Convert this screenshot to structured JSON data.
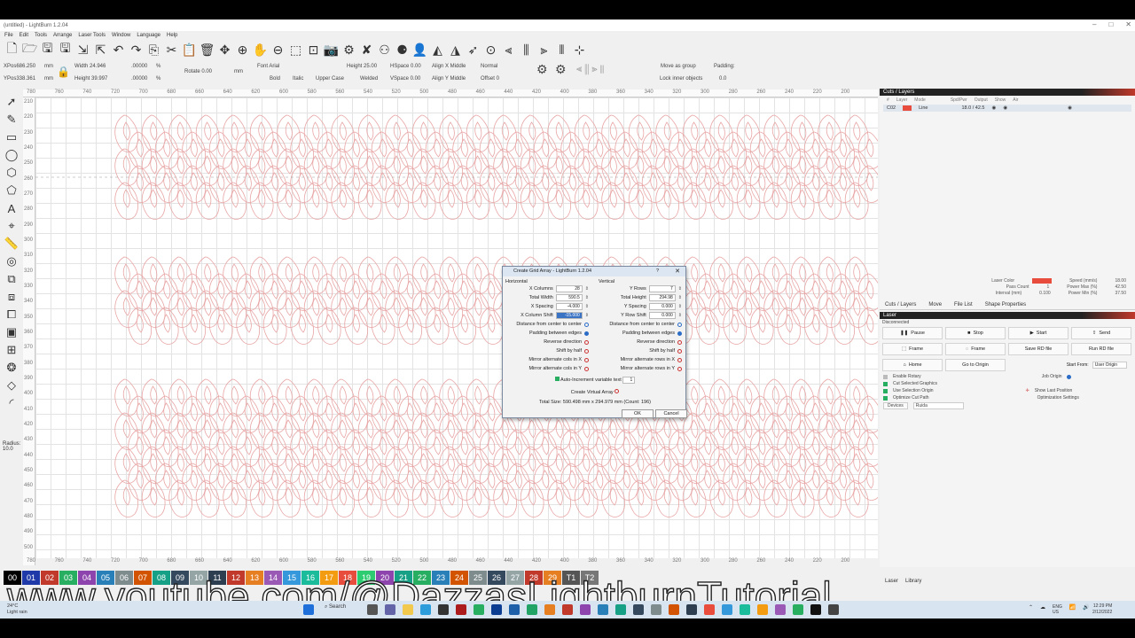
{
  "window": {
    "title": "(untitled) - LightBurn 1.2.04"
  },
  "menu": [
    "File",
    "Edit",
    "Tools",
    "Arrange",
    "Laser Tools",
    "Window",
    "Language",
    "Help"
  ],
  "toolbar2": {
    "xpos": "XPos686.250",
    "ypos": "YPos338.361",
    "mm": "mm",
    "width": "Width 24.946",
    "height": "Height 39.997",
    "pct_x": ".00000",
    "pct_y": ".00000",
    "pct": "%",
    "rotate": "Rotate 0.00",
    "rotate_mm": "mm",
    "font": "Font Arial",
    "font_height": "Height 25.00",
    "hspace": "HSpace 0.00",
    "vspace": "VSpace 0.00",
    "align_x": "Align X Middle",
    "align_y": "Align Y Middle",
    "normal": "Normal",
    "offset": "Offset 0",
    "bold": "Bold",
    "italic": "Italic",
    "upper": "Upper Case",
    "welded": "Welded",
    "move_group": "Move as group",
    "lock_inner": "Lock inner objects",
    "padding_label": "Padding:",
    "padding_value": "0.0"
  },
  "rulers": {
    "top": [
      "780",
      "760",
      "740",
      "720",
      "700",
      "680",
      "660",
      "640",
      "620",
      "600",
      "580",
      "560",
      "540",
      "520",
      "500",
      "480",
      "460",
      "440",
      "420",
      "400",
      "380",
      "360",
      "340",
      "320",
      "300",
      "280",
      "260",
      "240",
      "220",
      "200"
    ],
    "left": [
      "210",
      "220",
      "230",
      "240",
      "250",
      "260",
      "270",
      "280",
      "290",
      "300",
      "310",
      "320",
      "330",
      "340",
      "350",
      "360",
      "370",
      "380",
      "390",
      "400",
      "410",
      "420",
      "430",
      "440",
      "450",
      "460",
      "470",
      "480",
      "490",
      "500"
    ]
  },
  "radius": "Radius:",
  "radius_value": "10.0",
  "dialog": {
    "title": "Create Grid Array - LightBurn 1.2.04",
    "help": "?",
    "close": "✕",
    "horizontal": "Horizontal",
    "vertical": "Vertical",
    "h": {
      "x_columns_label": "X Columns",
      "x_columns": "28",
      "total_width_label": "Total Width",
      "total_width": "590.5",
      "x_spacing_label": "X Spacing",
      "x_spacing": "-4.000",
      "x_col_shift_label": "X Column Shift",
      "x_col_shift": "-15.000",
      "center": "Distance from center to center",
      "padding": "Padding between edges",
      "reverse": "Reverse direction",
      "shift_half": "Shift by half",
      "mirror_x": "Mirror alternate cols in X",
      "mirror_y": "Mirror alternate cols in Y"
    },
    "v": {
      "y_rows_label": "Y Rows",
      "y_rows": "7",
      "total_height_label": "Total Height",
      "total_height": "294.98",
      "y_spacing_label": "Y Spacing",
      "y_spacing": "0.000",
      "y_row_shift_label": "Y Row Shift",
      "y_row_shift": "0.000",
      "center": "Distance from center to center",
      "padding": "Padding between edges",
      "reverse": "Reverse direction",
      "shift_half": "Shift by half",
      "mirror_x": "Mirror alternate rows in X",
      "mirror_y": "Mirror alternate rows in Y"
    },
    "auto_inc_label": "Auto-Increment variable text",
    "auto_inc_value": "1",
    "virtual": "Create Virtual Array",
    "total": "Total Size: 590.498 mm x 294.979 mm  (Count: 196)",
    "ok": "OK",
    "cancel": "Cancel"
  },
  "cuts": {
    "header": "Cuts / Layers",
    "cols": [
      "#",
      "Layer",
      "Mode",
      "Spd/Pwr",
      "Output",
      "Show",
      "Air"
    ],
    "layer_num": "C02",
    "layer_mode": "Line",
    "layer_spd": "18.0 / 42.5",
    "layer_color": "#e74c3c"
  },
  "laser_props": {
    "laser_color": "Laser Color",
    "speed": "Speed (mm/s)",
    "speed_v": "18.00",
    "pass": "Pass Count",
    "pass_v": "1",
    "pmax": "Power Max (%)",
    "pmax_v": "42.50",
    "interval": "Interval (mm)",
    "interval_v": "0.100",
    "pmin": "Power Min (%)",
    "pmin_v": "37.50"
  },
  "tabs": [
    "Cuts / Layers",
    "Move",
    "File List",
    "Shape Properties"
  ],
  "laser": {
    "header": "Laser",
    "status": "Disconnected",
    "buttons": [
      "Pause",
      "Stop",
      "Start",
      "Send",
      "Frame",
      "Frame",
      "Save RD file",
      "Run RD file",
      "Home",
      "Go to Origin"
    ],
    "start_from": "Start From:",
    "start_from_v": "User Origin",
    "job_origin": "Job Origin",
    "enable_rotary": "Enable Rotary",
    "cut_selected": "Cut Selected Graphics",
    "use_selection": "Use Selection Origin",
    "optimize": "Optimize Cut Path",
    "show_last": "Show Last Position",
    "opt_settings": "Optimization Settings",
    "devices": "Devices",
    "device_name": "Ruida"
  },
  "bottom_tabs": [
    "Laser",
    "Library"
  ],
  "palette": [
    "00",
    "01",
    "02",
    "03",
    "04",
    "05",
    "06",
    "07",
    "08",
    "09",
    "10",
    "11",
    "12",
    "13",
    "14",
    "15",
    "16",
    "17",
    "18",
    "19",
    "20",
    "21",
    "22",
    "23",
    "24",
    "25",
    "26",
    "27",
    "28",
    "29",
    "T1",
    "T2"
  ],
  "watermark": "www.youtube.com/@DazzasLightburnTutorial",
  "taskbar": {
    "temp": "24°C",
    "weather": "Light rain",
    "search": "Search",
    "lang1": "ENG",
    "lang2": "US",
    "time": "12:29 PM",
    "date": "2/12/2022"
  }
}
